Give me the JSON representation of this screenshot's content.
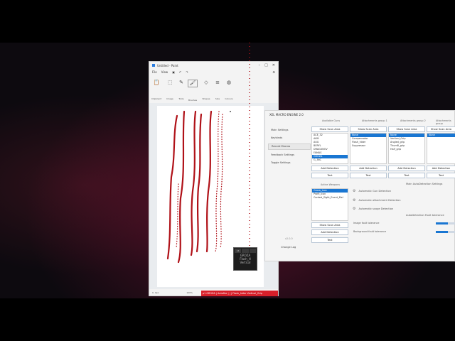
{
  "paint": {
    "title": "Untitled - Paint",
    "menu": [
      "File",
      "View"
    ],
    "tools": [
      {
        "label": "Clipboard",
        "icon": "clipboard-icon"
      },
      {
        "label": "Image",
        "icon": "image-icon"
      },
      {
        "label": "Tools",
        "icon": "pencil-icon"
      },
      {
        "label": "Brushes",
        "icon": "brush-icon"
      },
      {
        "label": "Shapes",
        "icon": "shapes-icon"
      },
      {
        "label": "Size",
        "icon": "size-icon"
      },
      {
        "label": "Colours",
        "icon": "palette-icon"
      }
    ],
    "status": {
      "pos": "0, 0px",
      "zoom": "100%"
    }
  },
  "macro": {
    "title": "XEL MACRO ENGINE 2.0",
    "nav": [
      {
        "label": "Main Settings"
      },
      {
        "label": "Keybinds"
      },
      {
        "label": "Record Macros",
        "active": true
      },
      {
        "label": "Feedback Settings"
      },
      {
        "label": "Toggle Settings"
      }
    ],
    "version": "v2.0.0",
    "clear_label": "Change Log",
    "columns": {
      "available_guns": "Available Guns",
      "group1": "Attachments group 1",
      "group2": "Attachments group 2",
      "group3": "Attachments group"
    },
    "show_scan_area": "Show Scan Area",
    "add_detection": "Add Detection",
    "test": "Test",
    "guns": [
      "ACE_32",
      "AKM",
      "AUG",
      "BERYL",
      "DRAGUNOV",
      "FAMAS",
      "GROZA",
      "G_36C"
    ],
    "group1_items": [
      "None",
      "Compensator",
      "Flash_hider",
      "Suppressor"
    ],
    "group2_items": [
      "None",
      "Vertical_Grip",
      "Angled_grip",
      "ThumB_grip",
      "Half_grip"
    ],
    "group3_items": [
      "None"
    ],
    "active_weapons_label": "Active Weapons",
    "active_weapons": [
      "Groza_Icon",
      "Profil_Icon",
      "Canted_Sight_Event_Mel"
    ],
    "main_auto_label": "Main AutoDetection Settings",
    "auto_options": [
      "Automatic Gun Detection",
      "Automatic attachment Detection",
      "Automatic scope Detection"
    ],
    "fault_label": "AutoDetection Fault tolerance",
    "fault_rows": [
      "Image fault tolerance",
      "Background fault tolerance"
    ],
    "fault_levels": [
      0.6,
      0.6
    ]
  },
  "overlay": {
    "cells": [
      "14",
      "",
      ""
    ],
    "lines": [
      "GROZA",
      "Flash_H",
      "Vertical"
    ]
  },
  "status_bar": {
    "text": "p1 GROZA | Autofire | | | Flash_hider Vertical_Grip"
  },
  "colors": {
    "stroke": "#b01118",
    "select": "#1976d2",
    "status_red": "#d81f2a"
  }
}
